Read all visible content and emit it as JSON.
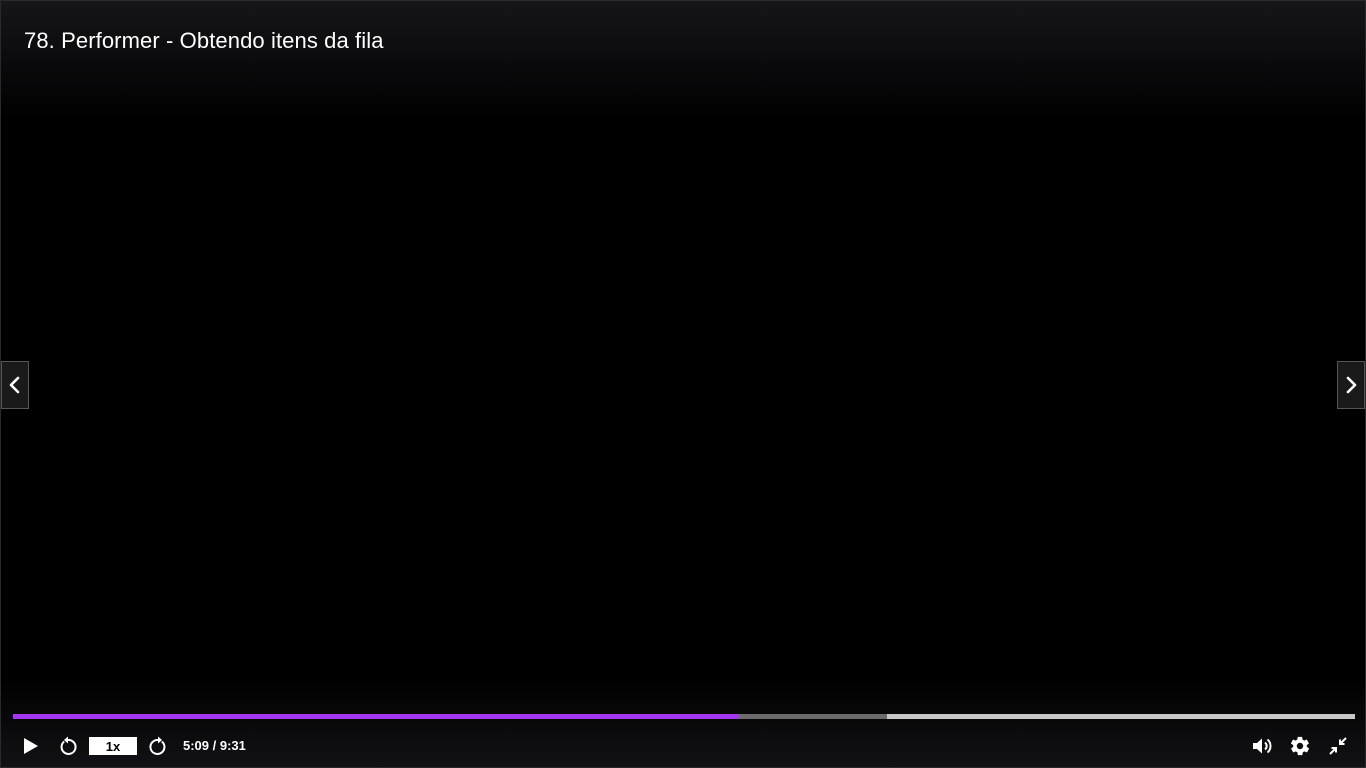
{
  "video": {
    "title": "78. Performer - Obtendo itens da fila"
  },
  "playback": {
    "speed_label": "1x",
    "time_label": "5:09 / 9:31",
    "current_time": "5:09",
    "duration": "9:31",
    "played_fraction": 0.541,
    "buffered_fraction": 0.651
  },
  "colors": {
    "progress_played": "#a435f0",
    "progress_buffered": "#6b6b6b",
    "progress_track": "#c8c8c8",
    "background": "#000000"
  },
  "icons": {
    "prev": "chevron-left-icon",
    "next": "chevron-right-icon",
    "play": "play-icon",
    "rewind": "rewind-icon",
    "forward": "forward-icon",
    "volume": "volume-icon",
    "settings": "gear-icon",
    "fullscreen": "exit-fullscreen-icon"
  }
}
